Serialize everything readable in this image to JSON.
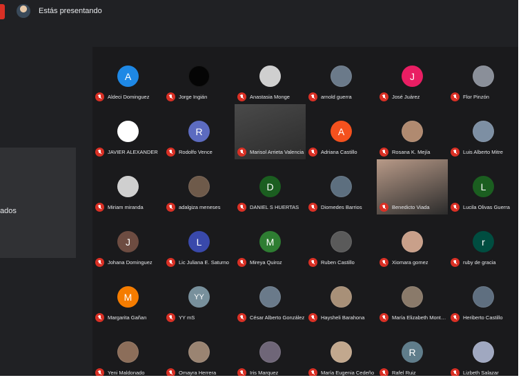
{
  "topbar": {
    "presenting_label": "Estás presentando"
  },
  "left_panel": {
    "partial_text": "ados"
  },
  "colors": {
    "background": "#202124",
    "mic_off": "#d93025",
    "tile_bg": "#1a1a1c"
  },
  "participants": [
    {
      "name": "Aldeci Dominguez",
      "initial": "A",
      "color": "#1e88e5"
    },
    {
      "name": "Jorge Ingián",
      "initial": "",
      "color": "#050505",
      "photo": true
    },
    {
      "name": "Anastasia Monge",
      "initial": "",
      "color": "#cfcfcf",
      "photo": true
    },
    {
      "name": "arnold guerra",
      "initial": "",
      "color": "#6b7a8a",
      "photo": true
    },
    {
      "name": "José Juárez",
      "initial": "J",
      "color": "#e91e63"
    },
    {
      "name": "Flor Pinzón",
      "initial": "",
      "color": "#8a8f99",
      "photo": true
    },
    {
      "name": "JAVIER ALEXANDER",
      "initial": "",
      "color": "#ffffff",
      "photo": true
    },
    {
      "name": "Rodolfo Vence",
      "initial": "R",
      "color": "#5c6bc0"
    },
    {
      "name": "Marisol Arrieta Valencia",
      "initial": "",
      "color": "#4a4a4a",
      "video": true
    },
    {
      "name": "Adriana Castillo",
      "initial": "A",
      "color": "#f4511e"
    },
    {
      "name": "Rosana K. Mejía",
      "initial": "",
      "color": "#b08a70",
      "photo": true
    },
    {
      "name": "Luis Alberto Mitre",
      "initial": "",
      "color": "#7d8fa3",
      "photo": true
    },
    {
      "name": "Miriam miranda",
      "initial": "",
      "color": "#cfcfcf",
      "photo": true
    },
    {
      "name": "adalgiza meneses",
      "initial": "",
      "color": "#6e5a4a",
      "photo": true
    },
    {
      "name": "DANIEL S HUERTAS",
      "initial": "D",
      "color": "#1b5e20"
    },
    {
      "name": "Diomedes Barrios",
      "initial": "",
      "color": "#5d6f7f",
      "photo": true
    },
    {
      "name": "Benedicto Viada",
      "initial": "",
      "color": "#b89a88",
      "video": true
    },
    {
      "name": "Lucila Olivas Guerra",
      "initial": "L",
      "color": "#1b5e20"
    },
    {
      "name": "Johana Dominguez",
      "initial": "J",
      "color": "#6d4c41"
    },
    {
      "name": "Lic Juliana E. Saturno",
      "initial": "L",
      "color": "#3949ab"
    },
    {
      "name": "Mireya Quiroz",
      "initial": "M",
      "color": "#2e7d32"
    },
    {
      "name": "Ruben Castillo",
      "initial": "",
      "color": "#5a5a5a",
      "photo": true
    },
    {
      "name": "Xiomara gomez",
      "initial": "",
      "color": "#c9a08a",
      "photo": true
    },
    {
      "name": "ruby de gracia",
      "initial": "r",
      "color": "#004d40"
    },
    {
      "name": "Margarita Gañan",
      "initial": "M",
      "color": "#f57c00"
    },
    {
      "name": "YY mS",
      "initial": "YY",
      "color": "#78909c"
    },
    {
      "name": "César Alberto González",
      "initial": "",
      "color": "#6a7a8a",
      "photo": true
    },
    {
      "name": "Haysheli Barahona",
      "initial": "",
      "color": "#a89078",
      "photo": true
    },
    {
      "name": "María Elizabeth Montenegro",
      "initial": "",
      "color": "#8a7a6a",
      "photo": true
    },
    {
      "name": "Heriberto Castillo",
      "initial": "",
      "color": "#5f6f80",
      "photo": true
    },
    {
      "name": "Yeni Maldonado",
      "initial": "",
      "color": "#8c6e5a",
      "photo": true
    },
    {
      "name": "Omayra Herrera",
      "initial": "",
      "color": "#9a8472",
      "photo": true
    },
    {
      "name": "Iris Marquez",
      "initial": "",
      "color": "#6f6678",
      "photo": true
    },
    {
      "name": "María Eugenia Cedeño",
      "initial": "",
      "color": "#c2a88e",
      "photo": true
    },
    {
      "name": "Rafel Ruiz",
      "initial": "R",
      "color": "#607d8b"
    },
    {
      "name": "Lizbeth Salazar",
      "initial": "",
      "color": "#a0a8c0",
      "photo": true
    }
  ]
}
